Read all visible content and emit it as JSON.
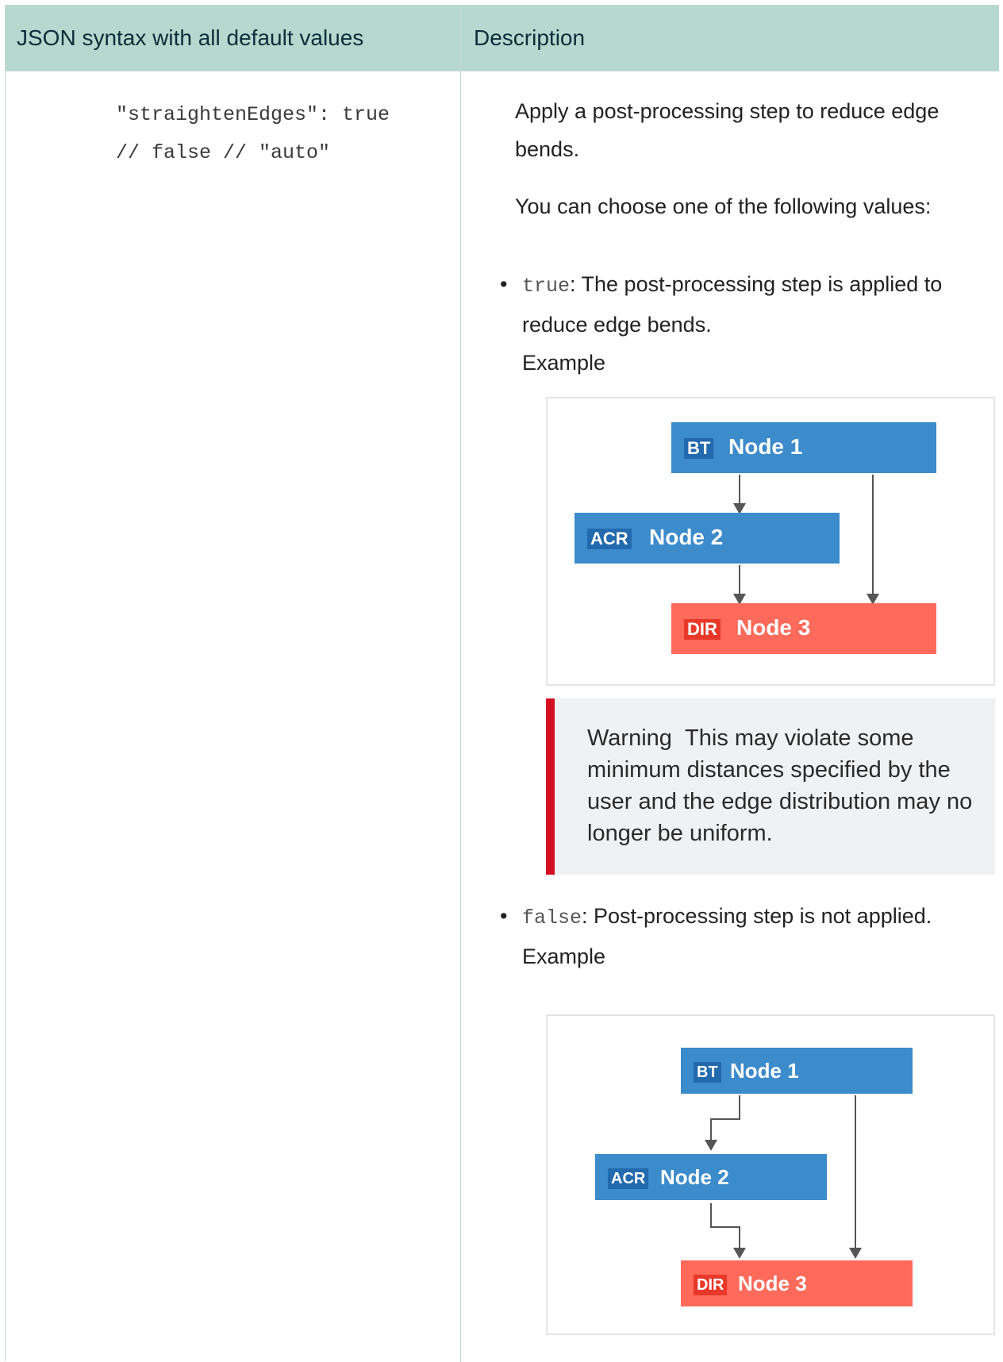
{
  "table": {
    "headers": {
      "json": "JSON syntax with all default values",
      "description": "Description"
    }
  },
  "code": {
    "line1": "\"straightenEdges\": true",
    "line2": "// false // \"auto\""
  },
  "description": {
    "intro": "Apply a post-processing step to reduce edge bends.",
    "choose": "You can choose one of the following values:",
    "options": [
      {
        "value": "true",
        "text": ": The post-processing step is applied to reduce edge bends.",
        "example_label": "Example"
      },
      {
        "value": "false",
        "text": ": Post-processing step is not applied.",
        "example_label": "Example"
      }
    ],
    "warning": {
      "label": "Warning",
      "text": "This may violate some minimum distances specified by the user and the edge distribution may no longer be uniform."
    }
  },
  "examples": [
    {
      "nodes": [
        {
          "tag": "BT",
          "name": "Node 1"
        },
        {
          "tag": "ACR",
          "name": "Node 2"
        },
        {
          "tag": "DIR",
          "name": "Node 3"
        }
      ]
    },
    {
      "nodes": [
        {
          "tag": "BT",
          "name": "Node 1"
        },
        {
          "tag": "ACR",
          "name": "Node 2"
        },
        {
          "tag": "DIR",
          "name": "Node 3"
        }
      ]
    }
  ],
  "colors": {
    "header_bg": "#b5d9cf",
    "node_blue": "#3c8bcb",
    "node_red": "#ff6a5a",
    "warning_bar": "#d40f22"
  }
}
